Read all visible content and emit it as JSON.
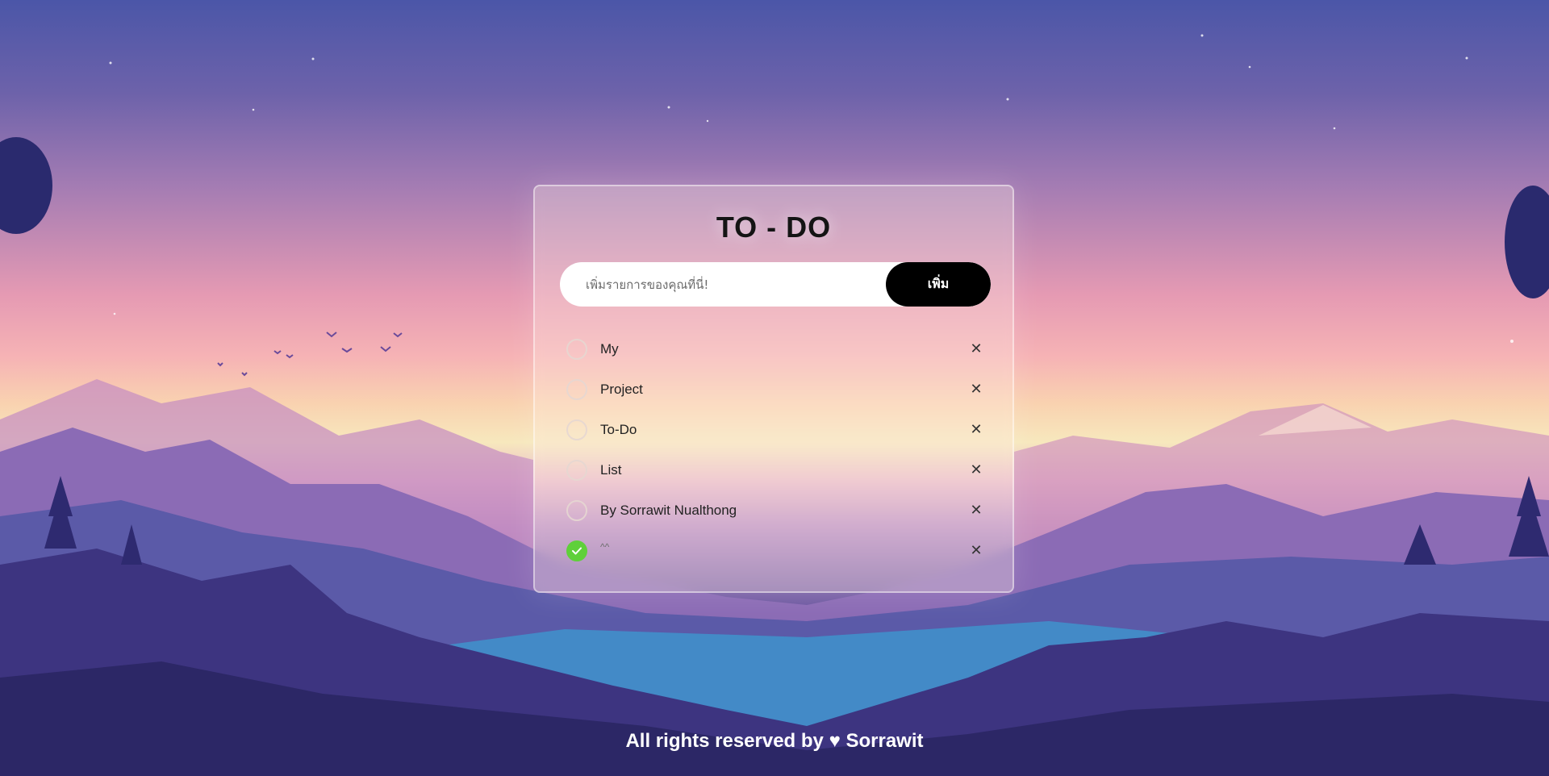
{
  "app": {
    "title": "TO - DO"
  },
  "input": {
    "placeholder": "เพิ่มรายการของคุณที่นี่!",
    "value": ""
  },
  "add_button": {
    "label": "เพิ่ม"
  },
  "tasks": [
    {
      "text": "My",
      "done": false
    },
    {
      "text": "Project",
      "done": false
    },
    {
      "text": "To-Do",
      "done": false
    },
    {
      "text": "List",
      "done": false
    },
    {
      "text": "By Sorrawit Nualthong",
      "done": false
    },
    {
      "text": "^^",
      "done": true
    }
  ],
  "delete_glyph": "✕",
  "footer": {
    "text": "All rights reserved by ♥ Sorrawit"
  },
  "colors": {
    "done_check": "#5fd03a",
    "button_bg": "#000000"
  }
}
